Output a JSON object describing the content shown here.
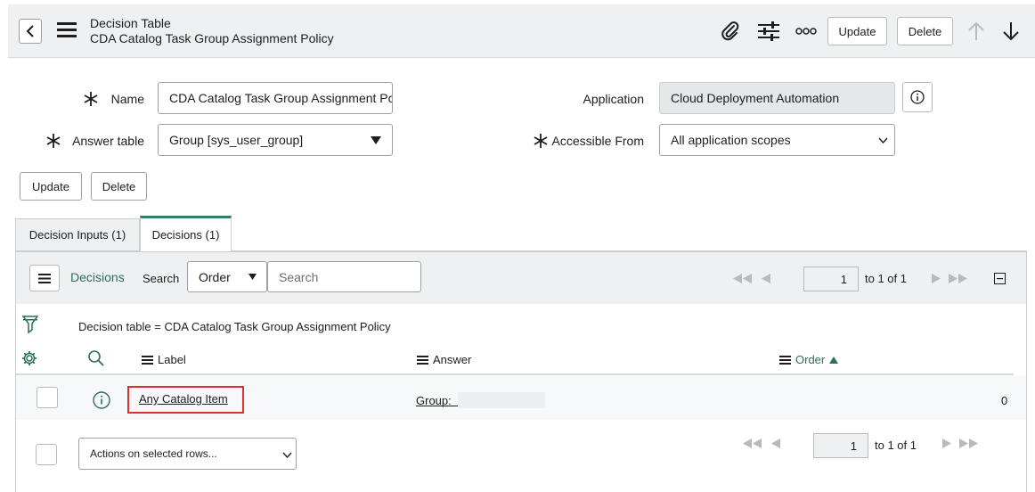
{
  "header": {
    "title": "Decision Table",
    "subtitle": "CDA Catalog Task Group Assignment Policy",
    "update_label": "Update",
    "delete_label": "Delete"
  },
  "form": {
    "name_label": "Name",
    "name_value": "CDA Catalog Task Group Assignment Pc",
    "answer_table_label": "Answer table",
    "answer_table_value": "Group [sys_user_group]",
    "application_label": "Application",
    "application_value": "Cloud Deployment Automation",
    "accessible_from_label": "Accessible From",
    "accessible_from_value": "All application scopes",
    "update_label": "Update",
    "delete_label": "Delete"
  },
  "tabs": [
    {
      "label": "Decision Inputs (1)",
      "active": false
    },
    {
      "label": "Decisions (1)",
      "active": true
    }
  ],
  "list": {
    "title": "Decisions",
    "search_label": "Search",
    "search_field": "Order",
    "search_placeholder": "Search",
    "page_value": "1",
    "page_total": "to 1 of 1",
    "filter_text": "Decision table = CDA Catalog Task Group Assignment Policy",
    "columns": {
      "label": "Label",
      "answer": "Answer",
      "order": "Order"
    },
    "rows": [
      {
        "label": "Any Catalog Item",
        "answer": "Group: ",
        "order": "0"
      }
    ],
    "actions_placeholder": "Actions on selected rows...",
    "footer_page_value": "1",
    "footer_page_total": "to 1 of 1"
  },
  "colors": {
    "accent": "#2e7d6b",
    "highlight": "#d9322b"
  }
}
